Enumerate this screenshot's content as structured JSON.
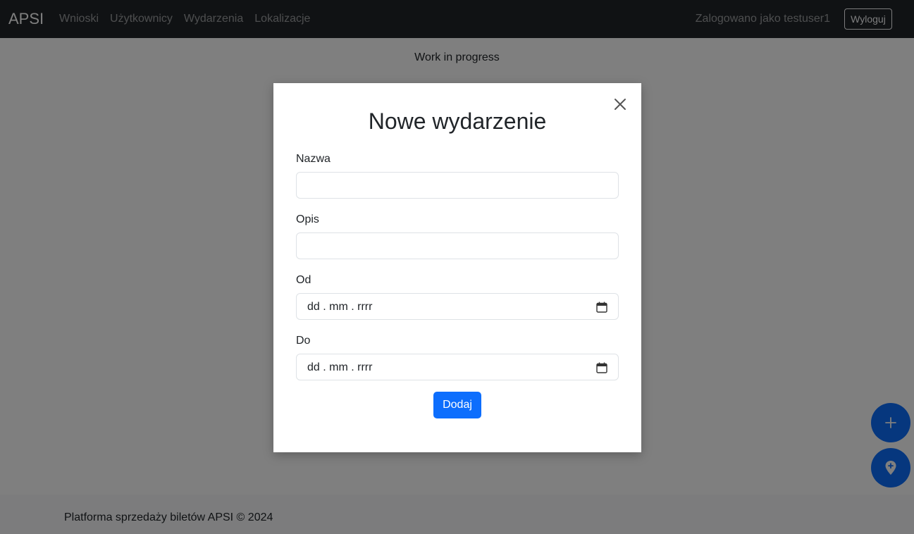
{
  "navbar": {
    "brand": "APSI",
    "links": [
      "Wnioski",
      "Użytkownicy",
      "Wydarzenia",
      "Lokalizacje"
    ],
    "user_text": "Zalogowano jako testuser1",
    "logout_label": "Wyloguj"
  },
  "main": {
    "text": "Work in progress"
  },
  "footer": {
    "text": "Platforma sprzedaży biletów APSI © 2024"
  },
  "modal": {
    "title": "Nowe wydarzenie",
    "fields": {
      "name": {
        "label": "Nazwa",
        "value": ""
      },
      "description": {
        "label": "Opis",
        "value": ""
      },
      "from": {
        "label": "Od",
        "placeholder": "dd . mm . rrrr"
      },
      "to": {
        "label": "Do",
        "placeholder": "dd . mm . rrrr"
      }
    },
    "submit_label": "Dodaj"
  },
  "icons": {
    "close": "close-icon",
    "calendar": "calendar-icon",
    "add": "plus-icon",
    "location": "location-pin-icon"
  },
  "colors": {
    "primary": "#0d6efd",
    "navbar": "#212529",
    "footer": "#f8f9fa"
  }
}
